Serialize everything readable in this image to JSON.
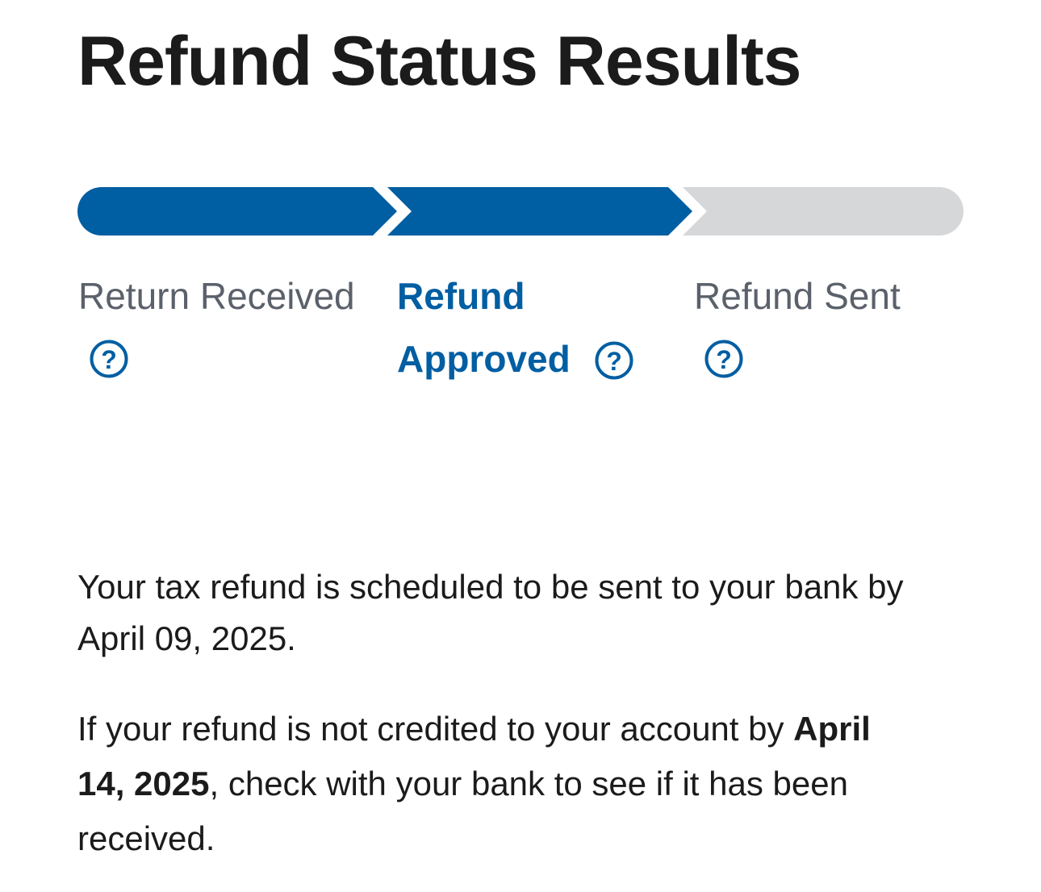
{
  "page": {
    "title": "Refund Status Results"
  },
  "progress": {
    "completed_color": "#005ea2",
    "pending_color": "#d6d7d9",
    "current_step_index": 1,
    "steps": [
      {
        "label": "Return Received",
        "state": "complete",
        "help_icon": "question-circle-icon"
      },
      {
        "label_line1": "Refund",
        "label_line2": "Approved",
        "state": "current",
        "help_icon": "question-circle-icon"
      },
      {
        "label": "Refund Sent",
        "state": "pending",
        "help_icon": "question-circle-icon"
      }
    ]
  },
  "message": {
    "schedule_line1": "Your tax refund is scheduled to be sent to your bank by",
    "schedule_line2": "April 09, 2025.",
    "credit_prefix": "If your refund is not credited to your account by ",
    "credit_date_part1": "April",
    "credit_date_part2": "14, 2025",
    "credit_suffix_line2": ", check with your bank to see if it has been",
    "credit_suffix_line3": "received."
  },
  "colors": {
    "accent": "#005ea2",
    "text": "#1b1b1b",
    "muted_text": "#5b616b"
  }
}
